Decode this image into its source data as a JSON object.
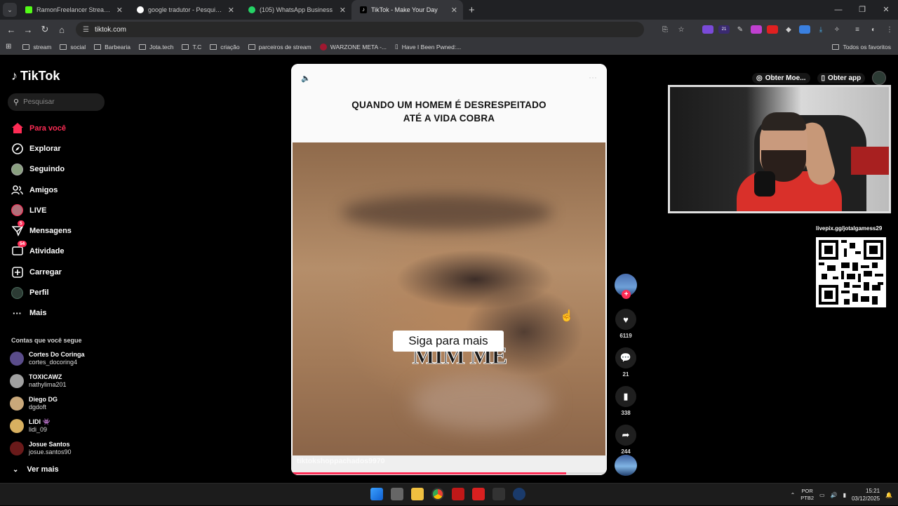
{
  "browser": {
    "tabs": [
      {
        "title": "RamonFreelancer Stream - Wat",
        "color": "#53fc18",
        "active": false
      },
      {
        "title": "google tradutor - Pesquisa Goo",
        "color": "#ffffff",
        "active": false
      },
      {
        "title": "(105) WhatsApp Business",
        "color": "#25d366",
        "active": false
      },
      {
        "title": "TikTok - Make Your Day",
        "color": "#000000",
        "active": true
      }
    ],
    "url": "tiktok.com",
    "bookmarks": [
      "stream",
      "social",
      "Barbearia",
      "Jota.tech",
      "T.C",
      "criação",
      "parceiros de stream",
      "WARZONE META -...",
      "Have I Been Pwned:..."
    ],
    "bookmarks_right": "Todos os favoritos",
    "ext_badge": "21"
  },
  "tiktok": {
    "logo": "TikTok",
    "search_placeholder": "Pesquisar",
    "nav": [
      {
        "label": "Para você",
        "icon": "home-icon"
      },
      {
        "label": "Explorar",
        "icon": "compass-icon"
      },
      {
        "label": "Seguindo",
        "icon": "following-avatar"
      },
      {
        "label": "Amigos",
        "icon": "friends-icon"
      },
      {
        "label": "LIVE",
        "icon": "live-avatar"
      },
      {
        "label": "Mensagens",
        "icon": "messages-icon",
        "badge": "5"
      },
      {
        "label": "Atividade",
        "icon": "activity-icon",
        "badge": "54"
      },
      {
        "label": "Carregar",
        "icon": "upload-icon"
      },
      {
        "label": "Perfil",
        "icon": "profile-avatar"
      },
      {
        "label": "Mais",
        "icon": "more-icon"
      }
    ],
    "following_title": "Contas que você segue",
    "accounts": [
      {
        "name": "Cortes Do Coringa",
        "handle": "cortes_docoring4",
        "color": "#5a4c8a"
      },
      {
        "name": "TOXICAWZ",
        "handle": "nathylima201",
        "color": "#a0a0a0"
      },
      {
        "name": "Diego DG",
        "handle": "dgdoft",
        "color": "#c9a87a"
      },
      {
        "name": "LIDI 👾",
        "handle": "lidi_09",
        "color": "#d8b060"
      },
      {
        "name": "Josue Santos",
        "handle": "josue.santos90",
        "color": "#6a1a1a"
      }
    ],
    "see_more": "Ver mais",
    "video": {
      "title_line1": "QUANDO UM HOMEM É DESRESPEITADO",
      "title_line2": "ATÉ A VIDA COBRA",
      "overlay_button": "Siga para mais",
      "subtitle": "MIM ME",
      "username": "tiktokshoppachados9970",
      "progress": 0.87
    },
    "actions": {
      "likes": "6119",
      "comments": "21",
      "saves": "338",
      "shares": "244"
    },
    "top_right": {
      "coins": "Obter Moe...",
      "app": "Obter app"
    }
  },
  "overlay": {
    "livepix": "livepix.gg/jotalgamess29"
  },
  "taskbar": {
    "lang1": "POR",
    "lang2": "PTB2",
    "time": "15:21",
    "date": "03/12/2025"
  }
}
